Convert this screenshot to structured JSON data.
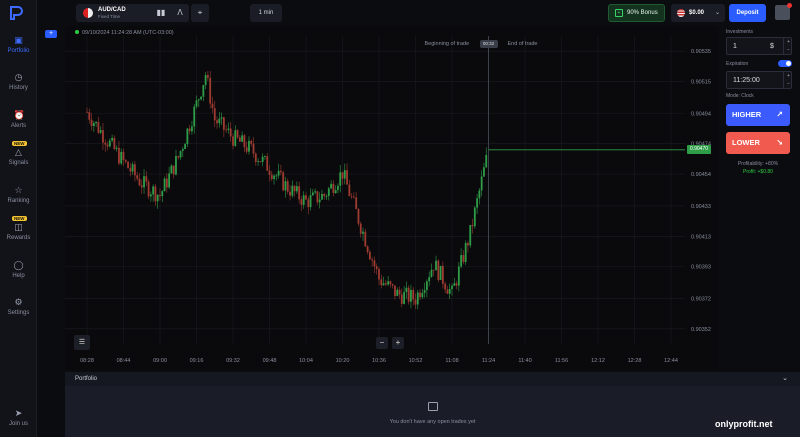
{
  "sidebar": {
    "items": [
      {
        "label": "Portfolio",
        "icon": "briefcase-icon",
        "active": true
      },
      {
        "label": "History",
        "icon": "history-icon"
      },
      {
        "label": "Alerts",
        "icon": "alarm-icon"
      },
      {
        "label": "Signals",
        "icon": "signals-icon",
        "badge": "NEW"
      },
      {
        "label": "Ranking",
        "icon": "trophy-icon"
      },
      {
        "label": "Rewards",
        "icon": "gift-icon",
        "badge": "NEW"
      },
      {
        "label": "Help",
        "icon": "help-icon"
      },
      {
        "label": "Settings",
        "icon": "gear-icon"
      }
    ],
    "join": {
      "label": "Join us",
      "icon": "telegram-icon"
    }
  },
  "topbar": {
    "pair": "AUD/CAD",
    "pair_sub": "Fixed Time",
    "timeframe": "1 min",
    "bonus": "90% Bonus",
    "balance": "$0.00",
    "deposit": "Deposit"
  },
  "chart": {
    "timestamp": "09/10/2024 11:24:28 AM (UTC-03:00)",
    "beginning_label": "Beginning of trade",
    "end_label": "End of trade",
    "timer": "00:32",
    "current_price": "0.90470",
    "y_ticks": [
      "0.90535",
      "0.90515",
      "0.90494",
      "0.90474",
      "0.90454",
      "0.90433",
      "0.90413",
      "0.90393",
      "0.90372",
      "0.90352"
    ],
    "x_ticks": [
      "08:28",
      "08:44",
      "09:00",
      "09:16",
      "09:32",
      "09:48",
      "10:04",
      "10:20",
      "10:36",
      "10:52",
      "11:08",
      "11:24",
      "11:40",
      "11:56",
      "12:12",
      "12:28",
      "12:44"
    ],
    "colors": {
      "up": "#2e9d48",
      "down": "#a03b32",
      "price_line": "#2e9d48"
    }
  },
  "chart_data": {
    "type": "candlestick",
    "title": "",
    "xlabel": "",
    "ylabel": "",
    "ylim": [
      0.90342,
      0.90545
    ],
    "series": [
      {
        "x": "08:28",
        "close": 0.90495
      },
      {
        "x": "08:36",
        "close": 0.90478
      },
      {
        "x": "08:44",
        "close": 0.90462
      },
      {
        "x": "08:52",
        "close": 0.90448
      },
      {
        "x": "09:00",
        "close": 0.9044
      },
      {
        "x": "09:08",
        "close": 0.90465
      },
      {
        "x": "09:16",
        "close": 0.905
      },
      {
        "x": "09:20",
        "close": 0.9052
      },
      {
        "x": "09:24",
        "close": 0.9049
      },
      {
        "x": "09:32",
        "close": 0.90478
      },
      {
        "x": "09:40",
        "close": 0.9047
      },
      {
        "x": "09:48",
        "close": 0.90458
      },
      {
        "x": "09:56",
        "close": 0.90445
      },
      {
        "x": "10:04",
        "close": 0.90436
      },
      {
        "x": "10:12",
        "close": 0.9044
      },
      {
        "x": "10:20",
        "close": 0.90455
      },
      {
        "x": "10:28",
        "close": 0.9042
      },
      {
        "x": "10:36",
        "close": 0.90385
      },
      {
        "x": "10:44",
        "close": 0.90375
      },
      {
        "x": "10:52",
        "close": 0.90372
      },
      {
        "x": "11:00",
        "close": 0.90395
      },
      {
        "x": "11:08",
        "close": 0.90375
      },
      {
        "x": "11:16",
        "close": 0.90415
      },
      {
        "x": "11:24",
        "close": 0.9047
      }
    ]
  },
  "panel": {
    "investment_label": "Investments",
    "investment_value": "1",
    "investment_currency": "$",
    "expiration_label": "Expiration",
    "expiration_value": "11:25:00",
    "mode": "Mode: Clock",
    "higher": "HIGHER",
    "lower": "LOWER",
    "profitability": "Profitability: +80%",
    "profit": "Profit: +$0.80"
  },
  "portfolio": {
    "title": "Portfolio",
    "empty": "You don't have any open trades yet"
  },
  "watermark": "onlyprofit.net"
}
